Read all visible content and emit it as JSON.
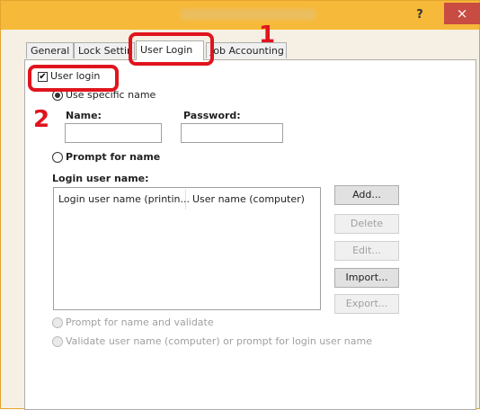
{
  "window": {
    "title": ""
  },
  "titlebar": {
    "help_label": "?",
    "close_label": "×"
  },
  "tabs": [
    {
      "label": "General"
    },
    {
      "label": "Lock Settin"
    },
    {
      "label": "User Login",
      "active": true
    },
    {
      "label": "Job Accounting"
    }
  ],
  "annotations": {
    "step1": "1",
    "step2": "2"
  },
  "user_login": {
    "checkbox_label": "User login",
    "checked": true
  },
  "specific_name": {
    "radio_label": "Use specific name",
    "name_label": "Name:",
    "name_value": "",
    "password_label": "Password:",
    "password_value": ""
  },
  "prompt_for_name": {
    "radio_label": "Prompt for name"
  },
  "login_user_name": {
    "label": "Login user name:",
    "columns": [
      "Login user name (printin...",
      "User name (computer)"
    ]
  },
  "buttons": {
    "add": "Add...",
    "delete": "Delete",
    "edit": "Edit...",
    "import": "Import...",
    "export": "Export..."
  },
  "options": {
    "prompt_validate": "Prompt for name and validate",
    "validate_user": "Validate user name (computer) or prompt for login user name"
  },
  "colors": {
    "titlebar": "#f6b93a",
    "highlight": "#e0141e",
    "close": "#c94c43"
  }
}
